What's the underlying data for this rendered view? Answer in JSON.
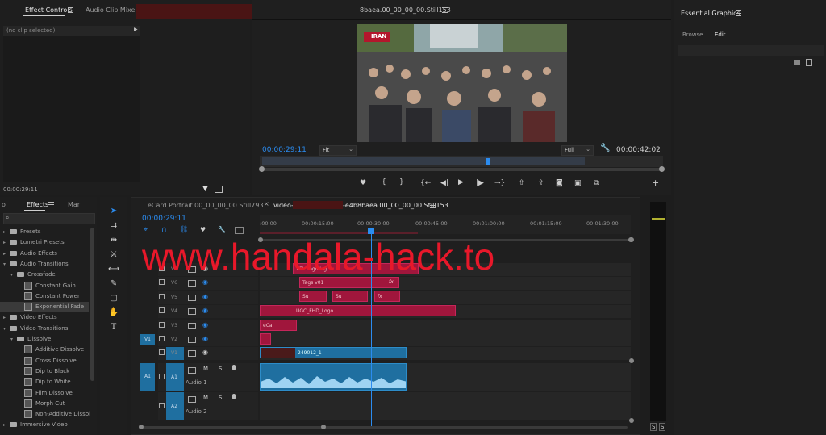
{
  "effect_controls": {
    "tab_effect_controls": "Effect Controls",
    "tab_audio_clip_mixer": "Audio Clip Mixer:",
    "no_clip": "(no clip selected)",
    "timecode": "00:00:29:11"
  },
  "program_monitor": {
    "title": "8baea.00_00_00_00.Still153",
    "overlay_logo": "IRAN",
    "current_timecode": "00:00:29:11",
    "fit_label": "Fit",
    "quality_label": "Full",
    "duration": "00:00:42:02"
  },
  "essential_graphics": {
    "title": "Essential Graphics",
    "tab_browse": "Browse",
    "tab_edit": "Edit"
  },
  "effects_panel": {
    "tab_prev": "o",
    "tab_effects": "Effects",
    "tab_markers": "Mar",
    "items": [
      {
        "label": "Presets",
        "kind": "folder",
        "indent": 1,
        "state": "closed"
      },
      {
        "label": "Lumetri Presets",
        "kind": "folder",
        "indent": 1,
        "state": "closed"
      },
      {
        "label": "Audio Effects",
        "kind": "folder",
        "indent": 1,
        "state": "closed"
      },
      {
        "label": "Audio Transitions",
        "kind": "folder",
        "indent": 1,
        "state": "open"
      },
      {
        "label": "Crossfade",
        "kind": "folder",
        "indent": 2,
        "state": "open"
      },
      {
        "label": "Constant Gain",
        "kind": "fx",
        "indent": 3,
        "state": ""
      },
      {
        "label": "Constant Power",
        "kind": "fx",
        "indent": 3,
        "state": ""
      },
      {
        "label": "Exponential Fade",
        "kind": "fx",
        "indent": 3,
        "state": "selected"
      },
      {
        "label": "Video Effects",
        "kind": "folder",
        "indent": 1,
        "state": "closed"
      },
      {
        "label": "Video Transitions",
        "kind": "folder",
        "indent": 1,
        "state": "open"
      },
      {
        "label": "Dissolve",
        "kind": "folder",
        "indent": 2,
        "state": "open"
      },
      {
        "label": "Additive Dissolve",
        "kind": "fx",
        "indent": 3,
        "state": ""
      },
      {
        "label": "Cross Dissolve",
        "kind": "fx",
        "indent": 3,
        "state": ""
      },
      {
        "label": "Dip to Black",
        "kind": "fx",
        "indent": 3,
        "state": ""
      },
      {
        "label": "Dip to White",
        "kind": "fx",
        "indent": 3,
        "state": ""
      },
      {
        "label": "Film Dissolve",
        "kind": "fx",
        "indent": 3,
        "state": ""
      },
      {
        "label": "Morph Cut",
        "kind": "fx",
        "indent": 3,
        "state": ""
      },
      {
        "label": "Non-Additive Dissol",
        "kind": "fx",
        "indent": 3,
        "state": ""
      },
      {
        "label": "Immersive Video",
        "kind": "folder",
        "indent": 1,
        "state": "closed"
      }
    ]
  },
  "timeline": {
    "tab1": "eCard Portrait.00_00_00_00.Still793",
    "tab2_prefix": "video-",
    "tab2_suffix": "-e4b8baea.00_00_00_00.Still153",
    "timecode": "00:00:29:11",
    "ruler": [
      ":00:00",
      "00:00:15:00",
      "00:00:30:00",
      "00:00:45:00",
      "00:01:00:00",
      "00:01:15:00",
      "00:01:30:00"
    ],
    "video_tracks": [
      "V7",
      "V6",
      "V5",
      "V4",
      "V3",
      "V2",
      "V1"
    ],
    "audio_tracks": [
      "A1",
      "A2"
    ],
    "audio_names": [
      "Audio 1",
      "Audio 2"
    ],
    "source_v": "V1",
    "source_a": "A1",
    "clips": {
      "v7": "XTL Logo Lig",
      "v6": "Tags v01",
      "v5a": "Su",
      "v5b": "Su",
      "v4": "UGC_FHD_Logo",
      "v3": "eCa",
      "v1": "249012_1",
      "fx": "fx"
    }
  },
  "watermark": "www.handala-hack.to",
  "colors": {
    "accent_blue": "#2b8cf0",
    "clip_pink": "#a0163c",
    "clip_blue": "#1f6fa0",
    "watermark_red": "#e8182a"
  },
  "meters": {
    "s_left": "S",
    "s_right": "S"
  }
}
